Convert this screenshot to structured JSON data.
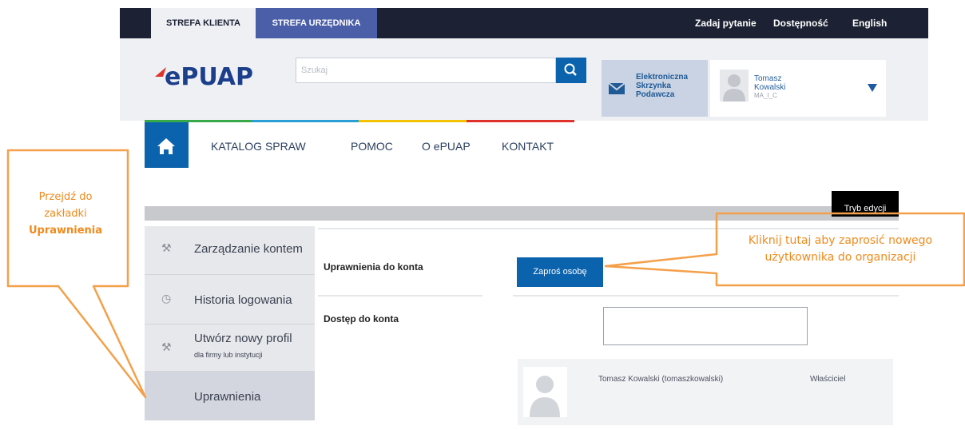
{
  "topbar": {
    "tab_klient": "STREFA KLIENTA",
    "tab_urzednik": "STREFA URZĘDNIKA",
    "links": [
      "Zadaj pytanie",
      "Dostępność",
      "English"
    ]
  },
  "header": {
    "logo_text": "ePUAP",
    "search_placeholder": "Szukaj",
    "box_line1": "Elektroniczna",
    "box_line2": "Skrzynka",
    "box_line3": "Podawcza",
    "user_first": "Tomasz",
    "user_last": "Kowalski",
    "user_role": "MA_I_C"
  },
  "nav": {
    "items": [
      "KATALOG SPRAW",
      "POMOC",
      "O ePUAP",
      "KONTAKT"
    ]
  },
  "tryb_label": "Tryb edycji",
  "sidebar": {
    "items": [
      {
        "label": "Zarządzanie kontem",
        "icon": "tools-icon"
      },
      {
        "label": "Historia logowania",
        "icon": "clock-icon"
      },
      {
        "label": "Utwórz nowy profil",
        "sublabel": "dla firmy lub instytucji",
        "icon": "tools-icon"
      },
      {
        "label": "Uprawnienia"
      }
    ]
  },
  "main": {
    "perms_label": "Uprawnienia do konta",
    "invite_label": "Zaproś osobę",
    "access_label": "Dostęp do konta",
    "member_name": "Tomasz Kowalski (tomaszkowalski)",
    "member_role": "Właściciel"
  },
  "callouts": {
    "left_line1": "Przejdź do",
    "left_line2": "zakładki",
    "left_bold": "Uprawnienia",
    "right_line1": "Kliknij tutaj aby zaprosić nowego",
    "right_line2": "użytkownika do organizacji"
  },
  "colors": {
    "navy": "#1c2233",
    "blue": "#0b63ad",
    "purple_tab": "#4a5fa8",
    "orange": "#f08a1c",
    "strip": [
      "#38a948",
      "#2a9fd6",
      "#f4c300",
      "#e0312a"
    ]
  }
}
